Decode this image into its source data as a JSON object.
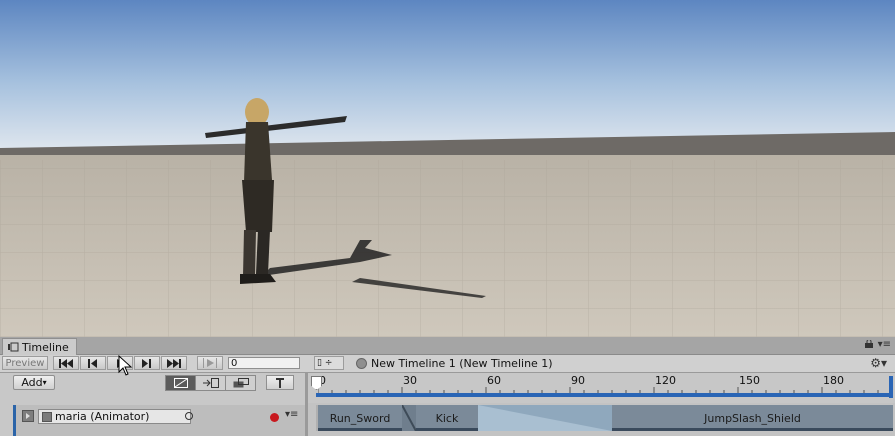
{
  "timeline_tab": {
    "label": "Timeline"
  },
  "toolbar": {
    "preview_label": "Preview",
    "frame_value": "0",
    "asset_label": "New Timeline 1 (New Timeline 1)"
  },
  "left_panel": {
    "add_label": "Add",
    "track": {
      "object_name": "maria (Animator)"
    }
  },
  "ruler": {
    "ticks": [
      "0",
      "30",
      "60",
      "90",
      "120",
      "150",
      "180"
    ]
  },
  "clips": [
    {
      "label": "Run_Sword"
    },
    {
      "label": "Kick"
    },
    {
      "label": "JumpSlash_Shield"
    }
  ],
  "colors": {
    "accent_blue": "#2a65b5",
    "record_red": "#c8191f",
    "clip": "#7b8a99",
    "blend": "#8fa8bd"
  },
  "icons": [
    "timeline-icon",
    "lock-icon",
    "menu-icon",
    "skip-start-icon",
    "prev-frame-icon",
    "play-icon",
    "next-frame-icon",
    "skip-end-icon",
    "play-range-icon",
    "gear-icon",
    "record-icon",
    "object-picker-icon",
    "pin-icon"
  ]
}
